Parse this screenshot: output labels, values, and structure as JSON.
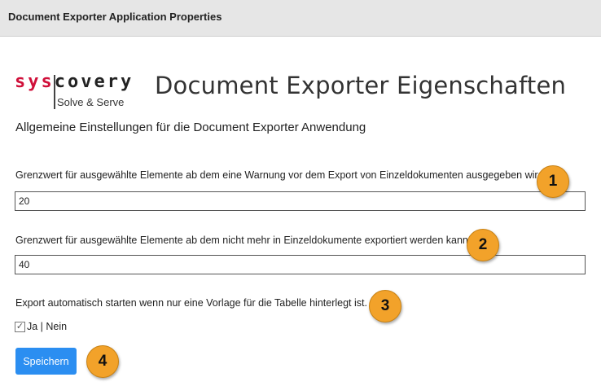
{
  "window": {
    "title": "Document Exporter Application Properties"
  },
  "logo": {
    "brand_sys": "sys",
    "brand_covery": "covery",
    "tagline": "Solve & Serve",
    "brand_color": "#d0103a"
  },
  "header": {
    "title": "Document Exporter Eigenschaften",
    "subtitle": "Allgemeine Einstellungen für die Document Exporter Anwendung"
  },
  "settings": {
    "warning_threshold": {
      "label": "Grenzwert für ausgewählte Elemente ab dem eine Warnung vor dem Export von Einzeldokumenten ausgegeben wird.",
      "value": "20"
    },
    "max_threshold": {
      "label": "Grenzwert für ausgewählte Elemente ab dem nicht mehr in Einzeldokumente exportiert werden kann.",
      "value": "40"
    },
    "auto_export": {
      "label": "Export automatisch starten wenn nur eine Vorlage für die Tabelle hinterlegt ist.",
      "checkbox_label": "Ja | Nein",
      "checked": true
    }
  },
  "actions": {
    "save_label": "Speichern",
    "save_color": "#2b8ef1"
  },
  "markers": [
    "1",
    "2",
    "3",
    "4"
  ],
  "marker_color": "#f2a22a"
}
